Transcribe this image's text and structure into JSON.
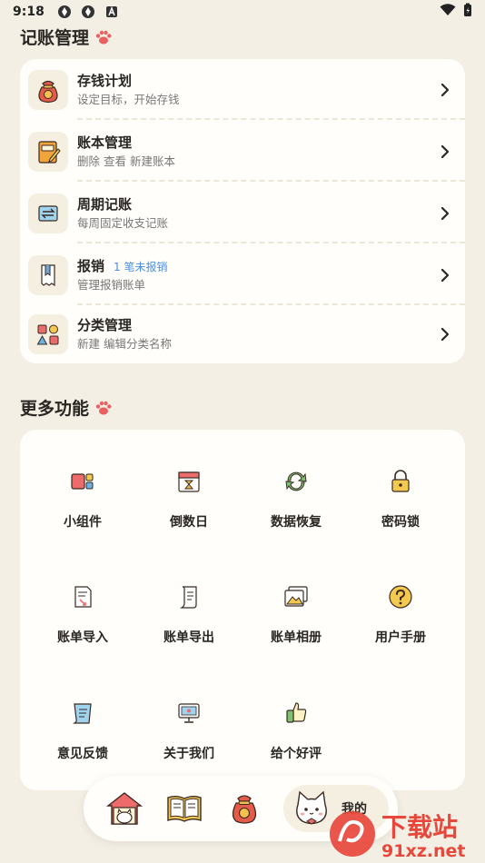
{
  "status_bar": {
    "time": "9:18"
  },
  "section_bookkeeping": {
    "title": "记账管理"
  },
  "list": [
    {
      "title": "存钱计划",
      "subtitle": "设定目标，开始存钱",
      "badge": "",
      "icon": "money-bag-icon"
    },
    {
      "title": "账本管理",
      "subtitle": "删除 查看 新建账本",
      "badge": "",
      "icon": "ledger-book-icon"
    },
    {
      "title": "周期记账",
      "subtitle": "每周固定收支记账",
      "badge": "",
      "icon": "cycle-calendar-icon"
    },
    {
      "title": "报销",
      "subtitle": "管理报销账单",
      "badge": "1 笔未报销",
      "icon": "receipt-icon"
    },
    {
      "title": "分类管理",
      "subtitle": "新建 编辑分类名称",
      "badge": "",
      "icon": "shapes-icon"
    }
  ],
  "section_more": {
    "title": "更多功能"
  },
  "grid": [
    {
      "label": "小组件",
      "icon": "widget-icon"
    },
    {
      "label": "倒数日",
      "icon": "countdown-calendar-icon"
    },
    {
      "label": "数据恢复",
      "icon": "restore-arrows-icon"
    },
    {
      "label": "密码锁",
      "icon": "padlock-icon"
    },
    {
      "label": "账单导入",
      "icon": "import-document-icon"
    },
    {
      "label": "账单导出",
      "icon": "export-scroll-icon"
    },
    {
      "label": "账单相册",
      "icon": "photo-album-icon"
    },
    {
      "label": "用户手册",
      "icon": "question-mark-icon"
    },
    {
      "label": "意见反馈",
      "icon": "feedback-scroll-icon"
    },
    {
      "label": "关于我们",
      "icon": "about-monitor-icon"
    },
    {
      "label": "给个好评",
      "icon": "thumbs-up-icon"
    }
  ],
  "bottom_nav": {
    "home_icon": "house-icon",
    "ledger_icon": "open-book-icon",
    "savings_icon": "money-bag-icon",
    "me_label": "我的",
    "me_icon": "cat-avatar-icon"
  },
  "watermark": {
    "text_top": "下载站",
    "text_bottom": "91xz.net"
  },
  "colors": {
    "background": "#f3efe5",
    "card": "#fffefb",
    "badge": "#4a8fe0",
    "icon_bg": "#f5efe2"
  }
}
